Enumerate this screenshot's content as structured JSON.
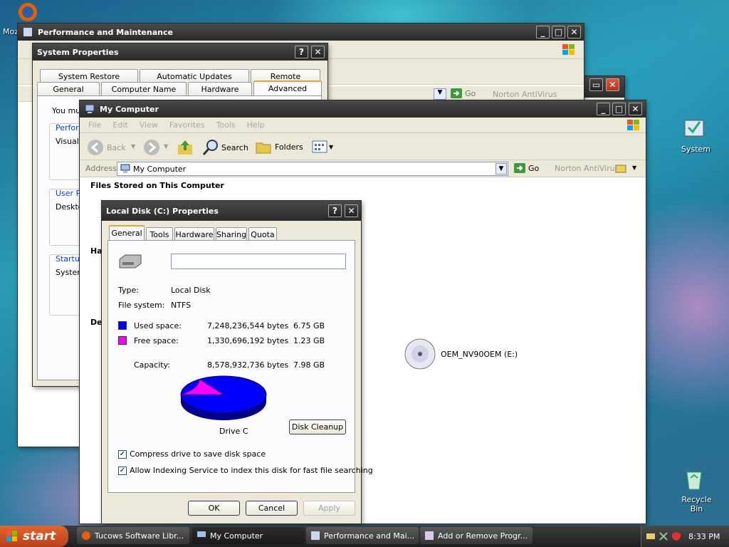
{
  "desktop": {
    "firefox_label": "Moz",
    "system_icon_label": "System",
    "recycle_label": "Recycle Bin"
  },
  "perf_window": {
    "title": "Performance and Maintenance",
    "address_go": "Go",
    "norton": "Norton AntiVirus"
  },
  "sysprops": {
    "title": "System Properties",
    "tabs_row1": [
      "System Restore",
      "Automatic Updates",
      "Remote"
    ],
    "tabs_row2": [
      "General",
      "Computer Name",
      "Hardware",
      "Advanced"
    ],
    "intro": "You mu",
    "groups": [
      {
        "title": "Perform",
        "text": "Visual"
      },
      {
        "title": "User P",
        "text": "Deskto"
      },
      {
        "title": "Startup",
        "text": "System"
      }
    ]
  },
  "behind_window": {
    "go": "Go",
    "norton": "Norton AntiVirus"
  },
  "my_computer": {
    "title": "My Computer",
    "menu": [
      "File",
      "Edit",
      "View",
      "Favorites",
      "Tools",
      "Help"
    ],
    "toolbar": {
      "back": "Back",
      "search": "Search",
      "folders": "Folders"
    },
    "address_label": "Address",
    "address_value": "My Computer",
    "go": "Go",
    "norton": "Norton AntiVirus",
    "section_files": "Files Stored on This Computer",
    "section_ha": "Ha",
    "section_de": "De",
    "drive_e": "OEM_NV90OEM (E:)"
  },
  "disk_props": {
    "title": "Local Disk (C:) Properties",
    "tabs": [
      "General",
      "Tools",
      "Hardware",
      "Sharing",
      "Quota"
    ],
    "name_value": "",
    "type_label": "Type:",
    "type_value": "Local Disk",
    "fs_label": "File system:",
    "fs_value": "NTFS",
    "used_label": "Used space:",
    "used_bytes": "7,248,236,544 bytes",
    "used_gb": "6.75 GB",
    "free_label": "Free space:",
    "free_bytes": "1,330,696,192 bytes",
    "free_gb": "1.23 GB",
    "cap_label": "Capacity:",
    "cap_bytes": "8,578,932,736 bytes",
    "cap_gb": "7.98 GB",
    "used_color": "#0000ff",
    "free_color": "#ff00ff",
    "used_fraction": 0.845,
    "drive_label": "Drive C",
    "cleanup": "Disk Cleanup",
    "compress": "Compress drive to save disk space",
    "indexing": "Allow Indexing Service to index this disk for fast file searching",
    "ok": "OK",
    "cancel": "Cancel",
    "apply": "Apply"
  },
  "taskbar": {
    "start": "start",
    "items": [
      "Tucows Software Libr...",
      "My Computer",
      "Performance and Mai...",
      "Add or Remove Progr..."
    ],
    "clock": "8:33 PM"
  }
}
